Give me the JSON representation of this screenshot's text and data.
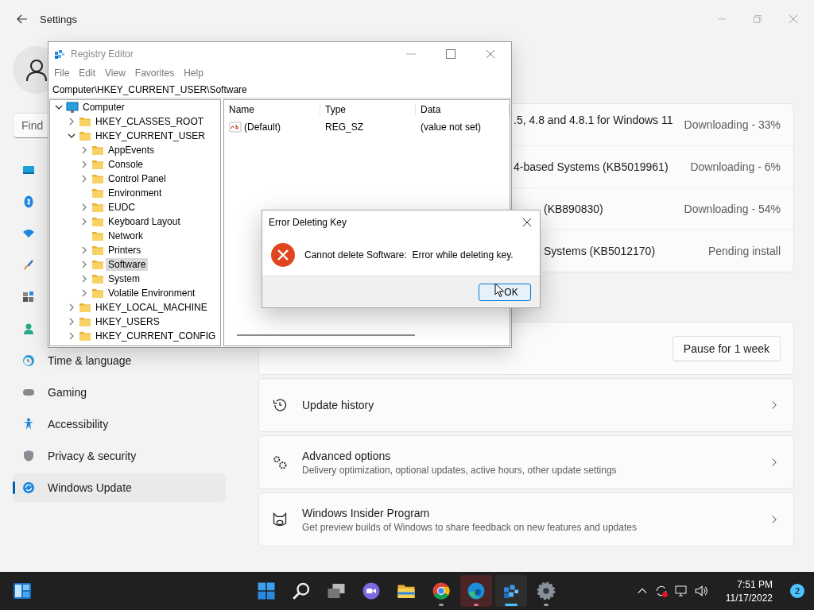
{
  "settings_window": {
    "title": "Settings",
    "search": {
      "placeholder": "Find"
    },
    "sidebar": {
      "items": [
        {
          "selected": false
        },
        {
          "selected": false
        },
        {
          "selected": false
        },
        {
          "selected": false
        },
        {
          "selected": false
        },
        {
          "selected": false
        },
        {
          "label": "Time & language",
          "selected": false
        },
        {
          "label": "Gaming",
          "selected": false
        },
        {
          "label": "Accessibility",
          "selected": false
        },
        {
          "label": "Privacy & security",
          "selected": false
        },
        {
          "label": "Windows Update",
          "selected": true
        }
      ]
    },
    "updates": [
      {
        "title": ".5, 4.8 and 4.8.1 for Windows 11",
        "status": "Downloading - 33%"
      },
      {
        "title": "4-based Systems (KB5019961)",
        "status": "Downloading - 6%"
      },
      {
        "title": "(KB890830)",
        "status": "Downloading - 54%"
      },
      {
        "title": "Systems (KB5012170)",
        "status": "Pending install"
      }
    ],
    "pause_button": "Pause for 1 week",
    "options": [
      {
        "title": "Update history"
      },
      {
        "title": "Advanced options",
        "subtitle": "Delivery optimization, optional updates, active hours, other update settings"
      },
      {
        "title": "Windows Insider Program",
        "subtitle": "Get preview builds of Windows to share feedback on new features and updates"
      }
    ]
  },
  "registry_editor": {
    "title": "Registry Editor",
    "menu": [
      "File",
      "Edit",
      "View",
      "Favorites",
      "Help"
    ],
    "address": "Computer\\HKEY_CURRENT_USER\\Software",
    "tree": [
      {
        "label": "Computer",
        "expanded": true,
        "selected": false,
        "children": [
          {
            "label": "HKEY_CLASSES_ROOT",
            "expanded": false,
            "selected": false
          },
          {
            "label": "HKEY_CURRENT_USER",
            "expanded": true,
            "selected": false,
            "children": [
              {
                "label": "AppEvents",
                "expanded": false,
                "selected": false
              },
              {
                "label": "Console",
                "expanded": false,
                "selected": false
              },
              {
                "label": "Control Panel",
                "expanded": false,
                "selected": false
              },
              {
                "label": "Environment",
                "selected": false
              },
              {
                "label": "EUDC",
                "expanded": false,
                "selected": false
              },
              {
                "label": "Keyboard Layout",
                "expanded": false,
                "selected": false
              },
              {
                "label": "Network",
                "selected": false
              },
              {
                "label": "Printers",
                "expanded": false,
                "selected": false
              },
              {
                "label": "Software",
                "expanded": false,
                "selected": true
              },
              {
                "label": "System",
                "expanded": false,
                "selected": false
              },
              {
                "label": "Volatile Environment",
                "expanded": false,
                "selected": false
              }
            ]
          },
          {
            "label": "HKEY_LOCAL_MACHINE",
            "expanded": false,
            "selected": false
          },
          {
            "label": "HKEY_USERS",
            "expanded": false,
            "selected": false
          },
          {
            "label": "HKEY_CURRENT_CONFIG",
            "expanded": false,
            "selected": false
          }
        ]
      }
    ],
    "columns": [
      "Name",
      "Type",
      "Data"
    ],
    "values": [
      {
        "name": "(Default)",
        "type": "REG_SZ",
        "data": "(value not set)"
      }
    ]
  },
  "error_dialog": {
    "title": "Error Deleting Key",
    "message": "Cannot delete Software:  Error while deleting key.",
    "button": "OK"
  },
  "taskbar": {
    "apps": [
      {
        "running": false,
        "active": false,
        "attention": false
      },
      {
        "running": false,
        "active": false,
        "attention": false
      },
      {
        "running": false,
        "active": false,
        "attention": false
      },
      {
        "running": false,
        "active": false,
        "attention": false
      },
      {
        "running": false,
        "active": false,
        "attention": false
      },
      {
        "running": true,
        "active": false,
        "attention": false
      },
      {
        "running": true,
        "active": false,
        "attention": true
      },
      {
        "running": true,
        "active": true,
        "attention": false
      },
      {
        "running": true,
        "active": false,
        "attention": false
      }
    ],
    "clock": {
      "time": "7:51 PM",
      "date": "11/17/2022"
    },
    "notification_count": "2"
  }
}
